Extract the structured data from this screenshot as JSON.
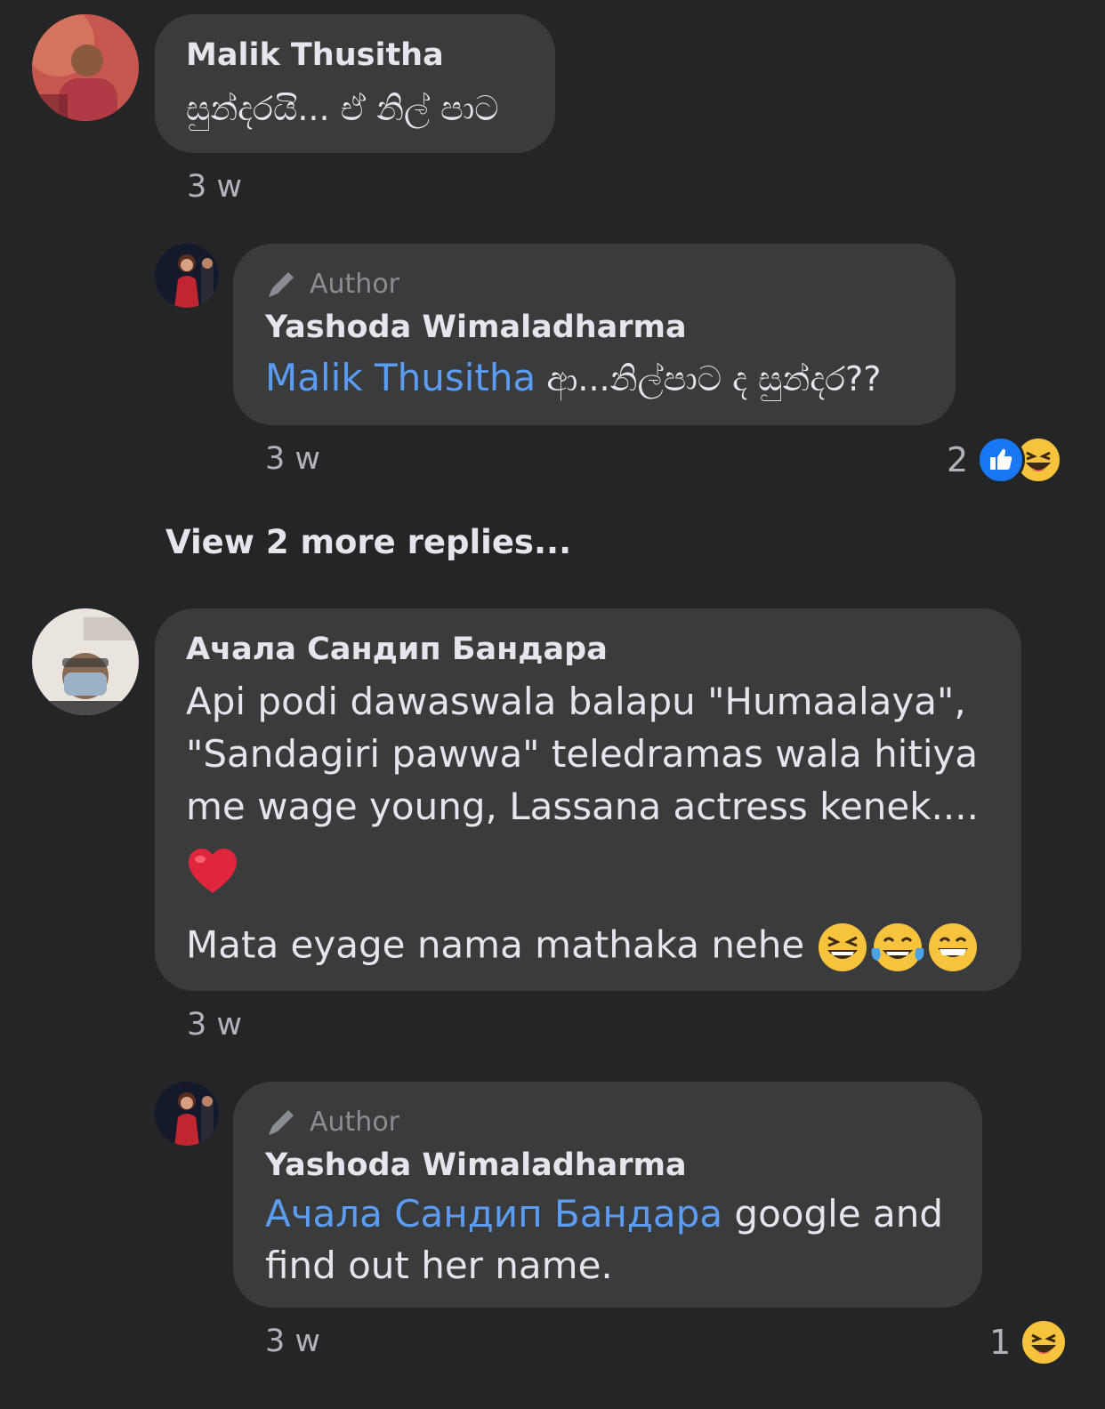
{
  "comments": [
    {
      "author": "Malik Thusitha",
      "text": "සුන්දරයි... ඒ නිල් පාට",
      "time": "3 w",
      "reply": {
        "badge": "Author",
        "author": "Yashoda Wimaladharma",
        "mention": "Malik Thusitha",
        "text": " ආ...නිල්පාට ද සුන්දර??",
        "time": "3 w",
        "reaction_count": "2",
        "reaction_icons": [
          "like-icon",
          "laugh-icon"
        ]
      },
      "view_more": "View 2 more replies..."
    },
    {
      "author": "Ачала Сандип Бандара",
      "lines": [
        "Api podi dawaswala balapu \"Humaalaya\",",
        "\"Sandagiri pawwa\" teledramas wala hitiya",
        "me wage young, Lassana actress kenek...."
      ],
      "heart": "red-heart-emoji",
      "last_line": "Mata eyage nama mathaka nehe",
      "last_emojis": [
        "laughing-emoji",
        "tears-of-joy-emoji",
        "grinning-emoji"
      ],
      "time": "3 w",
      "reply": {
        "badge": "Author",
        "author": "Yashoda Wimaladharma",
        "mention": "Ачала Сандип Бандара",
        "text": " google and",
        "text2": "find out her name.",
        "time": "3 w",
        "reaction_count": "1",
        "reaction_icons": [
          "laugh-icon"
        ]
      }
    }
  ],
  "colors": {
    "background": "#242526",
    "bubble": "#3a3b3c",
    "mention": "#5b9cf5",
    "secondary_text": "#b0b3b8",
    "like_blue": "#1877f2",
    "emoji_yellow": "#f7c33c"
  }
}
